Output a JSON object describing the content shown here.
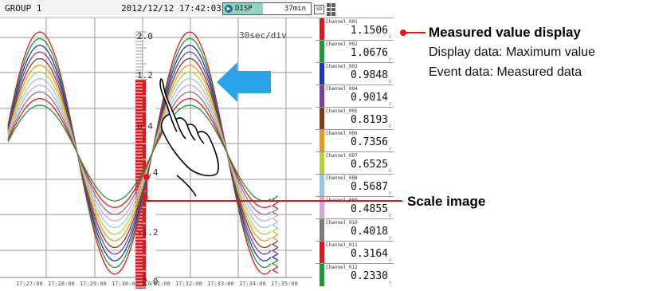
{
  "header": {
    "group": "GROUP 1",
    "datetime": "2012/12/12 17:42:03",
    "disp_label": "DISP",
    "disp_minutes": "37min",
    "memory_fill": 0.45,
    "sd_label": "SD"
  },
  "trend": {
    "time_div": "30sec/div",
    "scale_labels": [
      "2.0",
      "1.2",
      "0.4",
      "-0.4",
      "-1.2",
      "-2.0"
    ],
    "time_labels": [
      "17:27:00",
      "17:28:00",
      "17:29:00",
      "17:30:00",
      "17:31:00",
      "17:32:00",
      "17:33:00",
      "17:34:00",
      "17:35:00"
    ],
    "scale_range": [
      -2.0,
      2.0
    ]
  },
  "channels": [
    {
      "name": "Channel_001",
      "value": "1.1506",
      "unit": "V",
      "color": "#e8141b"
    },
    {
      "name": "Channel_002",
      "value": "1.0676",
      "unit": "V",
      "color": "#1b9a2f"
    },
    {
      "name": "Channel_003",
      "value": "0.9848",
      "unit": "V",
      "color": "#1336c8"
    },
    {
      "name": "Channel_004",
      "value": "0.9014",
      "unit": "V",
      "color": "#7b3fa8"
    },
    {
      "name": "Channel_005",
      "value": "0.8193",
      "unit": "V",
      "color": "#8a3a12"
    },
    {
      "name": "Channel_006",
      "value": "0.7356",
      "unit": "V",
      "color": "#f2931c"
    },
    {
      "name": "Channel_007",
      "value": "0.6525",
      "unit": "V",
      "color": "#b6cf3a"
    },
    {
      "name": "Channel_008",
      "value": "0.5687",
      "unit": "V",
      "color": "#8ec8ee"
    },
    {
      "name": "Channel_009",
      "value": "0.4855",
      "unit": "V",
      "color": "#d9a2dc"
    },
    {
      "name": "Channel_010",
      "value": "0.4018",
      "unit": "V",
      "color": "#7c7c7c"
    },
    {
      "name": "Channel_011",
      "value": "0.3164",
      "unit": "V",
      "color": "#e8141b"
    },
    {
      "name": "Channel_012",
      "value": "0.2330",
      "unit": "V",
      "color": "#1b9a2f"
    }
  ],
  "annotations": {
    "measured_title": "Measured value display",
    "measured_line1": "Display data: Maximum value",
    "measured_line2": "Event data: Measured data",
    "scale_title": "Scale image"
  },
  "colors": {
    "scale_bar": "#e8141b",
    "arrow": "#2aa4e6"
  },
  "icons": {
    "hand": "pointing-hand-icon",
    "arrow": "left-arrow-icon"
  }
}
